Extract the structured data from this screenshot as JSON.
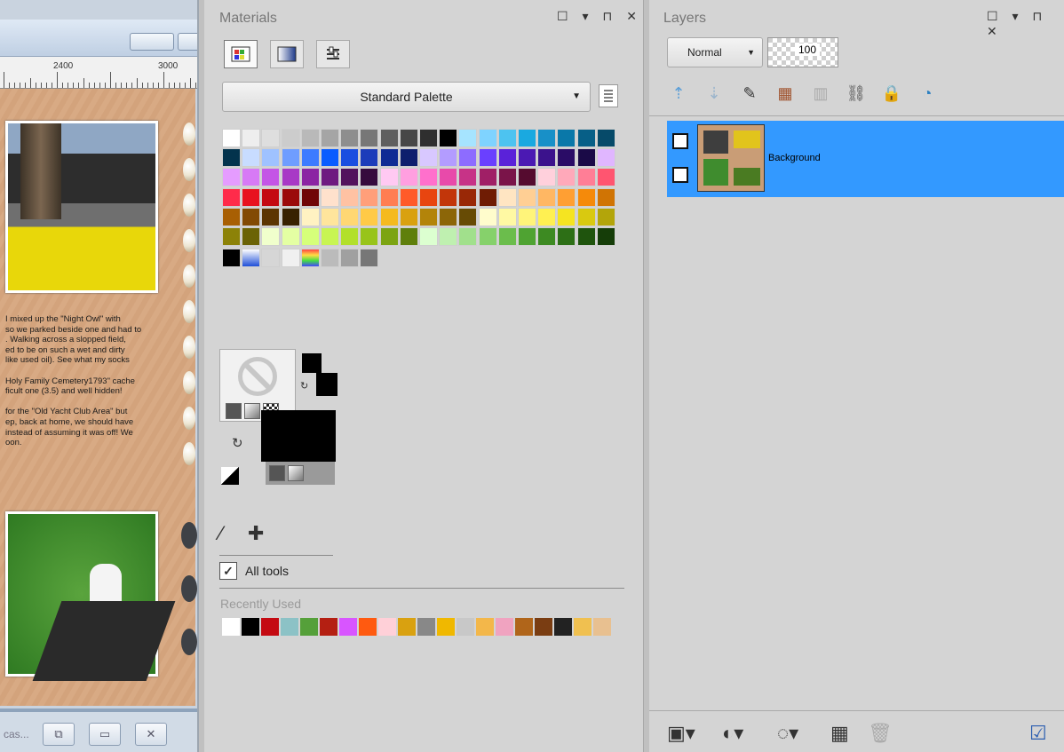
{
  "canvas": {
    "ruler_labels": [
      "2400",
      "3000"
    ],
    "journal_text": "I mixed up the \"Night Owl\" with\nso we parked beside one and had to\n. Walking across a slopped field,\ned to be on such a wet and dirty\nlike used oil). See what my socks\n\nHoly Family Cemetery1793\" cache\nficult one (3.5) and well hidden!\n\nfor the \"Old Yacht Club Area\" but\nep, back at home, we should have\ninstead of assuming it was off! We\noon.",
    "taskbar_label": "cas..."
  },
  "materials": {
    "title": "Materials",
    "panel_controls": [
      "☐",
      "▾",
      "⊓",
      "✕"
    ],
    "palette_name": "Standard Palette",
    "swatches": [
      [
        "#ffffff",
        "#eeeeee",
        "#dedede",
        "#cccccc",
        "#b9b9b9",
        "#a5a5a5",
        "#8e8e8e",
        "#777777",
        "#5f5f5f",
        "#474747",
        "#2f2f2f",
        "#000000",
        "#a6e4ff",
        "#7fd3ff",
        "#4dc3f0",
        "#1aa9e0",
        "#1890c8",
        "#0a78a9",
        "#075f87",
        "#064a69"
      ],
      [
        "#03334d",
        "#c8dcff",
        "#9fc2ff",
        "#6f9dff",
        "#3d7bff",
        "#0a5cff",
        "#1a4ee0",
        "#1c3cba",
        "#0f2b94",
        "#0e1f6d",
        "#d8c8ff",
        "#b39cff",
        "#8d6cff",
        "#6a40ff",
        "#5a22d9",
        "#4b19b3",
        "#3b128c",
        "#2a0c66",
        "#1a0a47",
        "#e0b6ff"
      ],
      [
        "#e59cff",
        "#d77af5",
        "#c455e6",
        "#a839c6",
        "#8b25a3",
        "#6e1a80",
        "#52135d",
        "#360b3d",
        "#ffc9f2",
        "#ff9fe0",
        "#ff70cc",
        "#e84aaa",
        "#c73387",
        "#a01f66",
        "#7a1449",
        "#550b2f",
        "#ffd0dc",
        "#ffa9ba",
        "#ff7e96",
        "#ff5570"
      ],
      [
        "#ff2b4a",
        "#e8121f",
        "#c40a12",
        "#9b0a0b",
        "#700607",
        "#ffe1cc",
        "#ffc2a3",
        "#ff9f7a",
        "#ff7d52",
        "#ff5a29",
        "#e84510",
        "#c2360a",
        "#992806",
        "#6f1c04",
        "#ffe5c2",
        "#ffcf94",
        "#ffb763",
        "#ff9f33",
        "#f58a0a",
        "#d07404"
      ],
      [
        "#a85f03",
        "#824a04",
        "#5c3502",
        "#382101",
        "#fff2c2",
        "#ffe59c",
        "#ffd773",
        "#ffca47",
        "#f5ba1f",
        "#d9a110",
        "#b3840a",
        "#8c6608",
        "#674b05",
        "#fffccc",
        "#fff9a3",
        "#fff47a",
        "#fff052",
        "#f5e421",
        "#d9c910",
        "#b3a50a"
      ],
      [
        "#8c8208",
        "#6b6305",
        "#f0ffcc",
        "#e4ffa3",
        "#d6ff7a",
        "#c8f552",
        "#b2e02b",
        "#98c41a",
        "#7ca412",
        "#5f7f0c",
        "#dcffd0",
        "#bff0b0",
        "#a1e08c",
        "#86d16b",
        "#6bbd4c",
        "#4fa332",
        "#3d8a22",
        "#2d6f16",
        "#1f540d",
        "#153d08"
      ]
    ],
    "special_swatches": [
      "#000000",
      "#1e4fd8",
      "#d6d6d6",
      "#f0f0f0",
      "#ff4d4d",
      "#bbbbbb",
      "#a0a0a0",
      "#777777"
    ],
    "all_tools_label": "All tools",
    "all_tools_checked": "✓",
    "recently_used_label": "Recently Used",
    "recent_colors": [
      "#ffffff",
      "#000000",
      "#c40a12",
      "#8cc2c6",
      "#55a03a",
      "#b41f12",
      "#d855ff",
      "#ff5a10",
      "#ffd0d8",
      "#d9a110",
      "#888888",
      "#f0b800",
      "#c8c8c8",
      "#f3b74a",
      "#f0a3c0",
      "#b0651a",
      "#7a3d12",
      "#222222",
      "#f0c050",
      "#e8c090"
    ]
  },
  "layers": {
    "title": "Layers",
    "panel_controls": [
      "☐",
      "▾",
      "⊓",
      "✕"
    ],
    "blend_mode": "Normal",
    "opacity": "100",
    "layer_name": "Background",
    "selection_color": "#3399ff"
  }
}
